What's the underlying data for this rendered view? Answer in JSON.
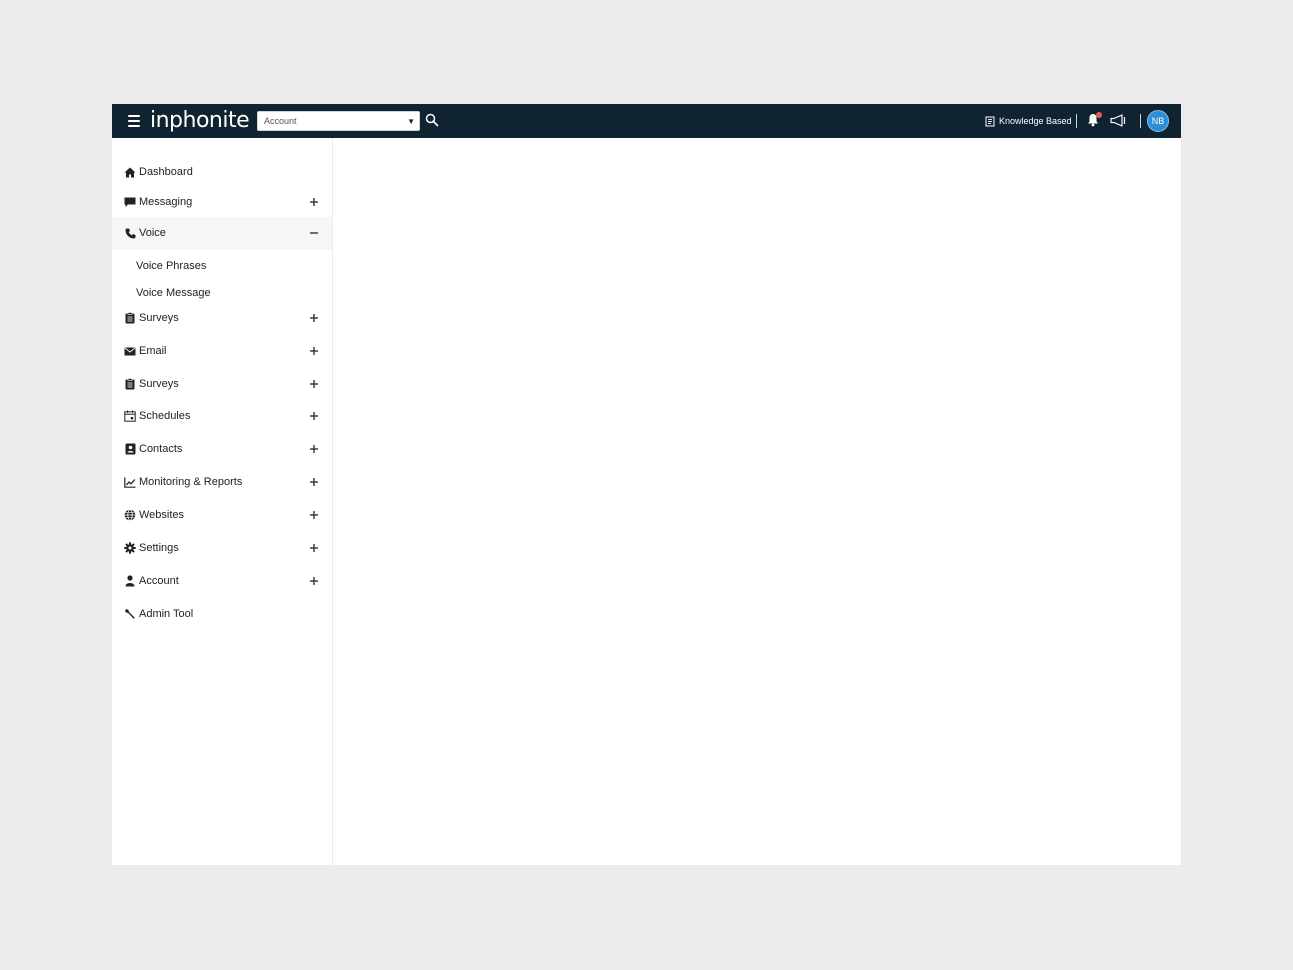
{
  "header": {
    "brand": "inphonite",
    "account_select": {
      "value": "Account"
    },
    "knowledge_label": "Knowledge Based",
    "avatar_initials": "NB",
    "colors": {
      "bar": "#0f2430",
      "avatar": "#2f8fd6",
      "notification": "#e85c5c"
    }
  },
  "sidebar": {
    "items": [
      {
        "label": "Dashboard",
        "icon": "home-icon",
        "toggle": ""
      },
      {
        "label": "Messaging",
        "icon": "chat-icon",
        "toggle": "+"
      },
      {
        "label": "Voice",
        "icon": "phone-icon",
        "toggle": "−",
        "expanded": true,
        "children": [
          "Voice Phrases",
          "Voice Message"
        ]
      },
      {
        "label": "Surveys",
        "icon": "clipboard-icon",
        "toggle": "+"
      },
      {
        "label": "Email",
        "icon": "envelope-icon",
        "toggle": "+"
      },
      {
        "label": "Surveys",
        "icon": "clipboard-icon",
        "toggle": "+"
      },
      {
        "label": "Schedules",
        "icon": "calendar-icon",
        "toggle": "+"
      },
      {
        "label": "Contacts",
        "icon": "contact-card-icon",
        "toggle": "+"
      },
      {
        "label": "Monitoring & Reports",
        "icon": "line-chart-icon",
        "toggle": "+"
      },
      {
        "label": "Websites",
        "icon": "globe-icon",
        "toggle": "+"
      },
      {
        "label": "Settings",
        "icon": "gear-icon",
        "toggle": "+"
      },
      {
        "label": "Account",
        "icon": "user-icon",
        "toggle": "+"
      },
      {
        "label": "Admin Tool",
        "icon": "wrench-icon",
        "toggle": ""
      }
    ]
  }
}
